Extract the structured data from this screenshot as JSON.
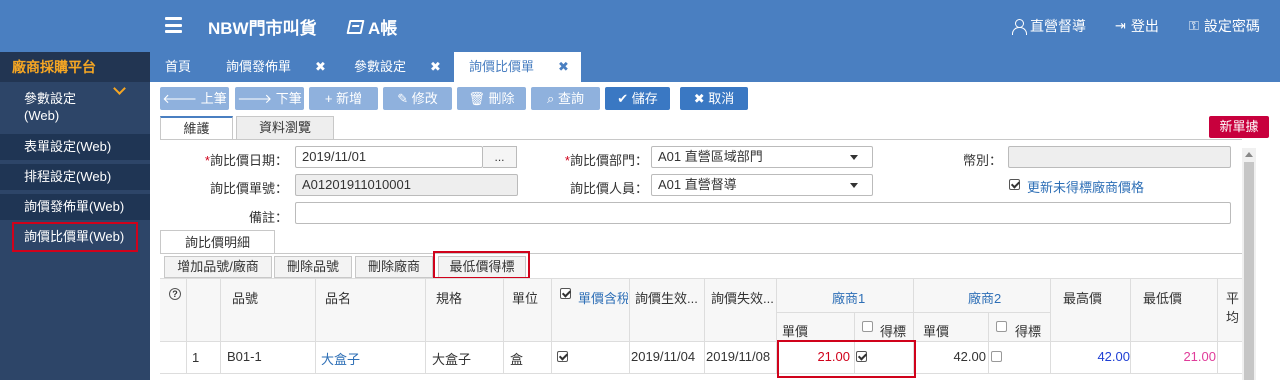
{
  "header": {
    "app_title": "NBW門市叫貨",
    "book_title": "A帳",
    "nav": {
      "user": "直營督導",
      "logout": "登出",
      "password": "設定密碼"
    }
  },
  "sidebar": {
    "title": "廠商採購平台",
    "items": [
      {
        "label": "參數設定",
        "label2": "(Web)"
      },
      {
        "label": "表單設定(Web)"
      },
      {
        "label": "排程設定(Web)"
      },
      {
        "label": "詢價發佈單(Web)"
      },
      {
        "label": "詢價比價單(Web)"
      }
    ]
  },
  "tabs": [
    {
      "label": "首頁"
    },
    {
      "label": "詢價發佈單"
    },
    {
      "label": "參數設定"
    },
    {
      "label": "詢價比價單"
    }
  ],
  "tab_close": "✖",
  "toolbar": {
    "prev": "上筆",
    "next": "下筆",
    "add": "新增",
    "edit": "修改",
    "delete": "刪除",
    "query": "查詢",
    "save": "儲存",
    "cancel": "取消"
  },
  "subtabs": {
    "maintain": "維護",
    "browse": "資料瀏覽"
  },
  "new_badge": "新單據",
  "form": {
    "date_label": "詢比價日期：",
    "date_value": "2019/11/01",
    "ellipsis": "...",
    "dept_label": "詢比價部門：",
    "dept_value": "A01 直營區域部門",
    "currency_label": "幣別：",
    "no_label": "詢比價單號：",
    "no_value": "A01201911010001",
    "person_label": "詢比價人員：",
    "person_value": "A01 直營督導",
    "update_label": "更新未得標廠商價格",
    "update_checked": true,
    "remark_label": "備註：",
    "required_mark": "*"
  },
  "detail": {
    "tab": "詢比價明細",
    "buttons": {
      "add_vendor": "增加品號/廠商",
      "del_item": "刪除品號",
      "del_vendor": "刪除廠商",
      "lowest": "最低價得標"
    }
  },
  "grid": {
    "headers": {
      "help": "?",
      "item_no": "品號",
      "item_name": "品名",
      "spec": "規格",
      "unit": "單位",
      "tax_incl": "單價含稅",
      "eff_from": "詢價生效...",
      "eff_to": "詢價失效...",
      "vendor1": "廠商1",
      "vendor2": "廠商2",
      "unit_price": "單價",
      "win": "得標",
      "max_price": "最高價",
      "min_price": "最低價",
      "avg": "平均"
    },
    "rows": [
      {
        "seq": "1",
        "item_no": "B01-1",
        "item_name": "大盒子",
        "spec": "大盒子",
        "unit": "盒",
        "tax_incl": true,
        "eff_from": "2019/11/04",
        "eff_to": "2019/11/08",
        "v1_price": "21.00",
        "v1_win": true,
        "v2_price": "42.00",
        "v2_win": false,
        "max_price": "42.00",
        "min_price": "21.00"
      }
    ]
  },
  "colors": {
    "primary": "#4a7fc1",
    "sidebar": "#2d4568",
    "accent": "#f5a623",
    "badge": "#c8003d",
    "highlight": "#d0021b"
  }
}
